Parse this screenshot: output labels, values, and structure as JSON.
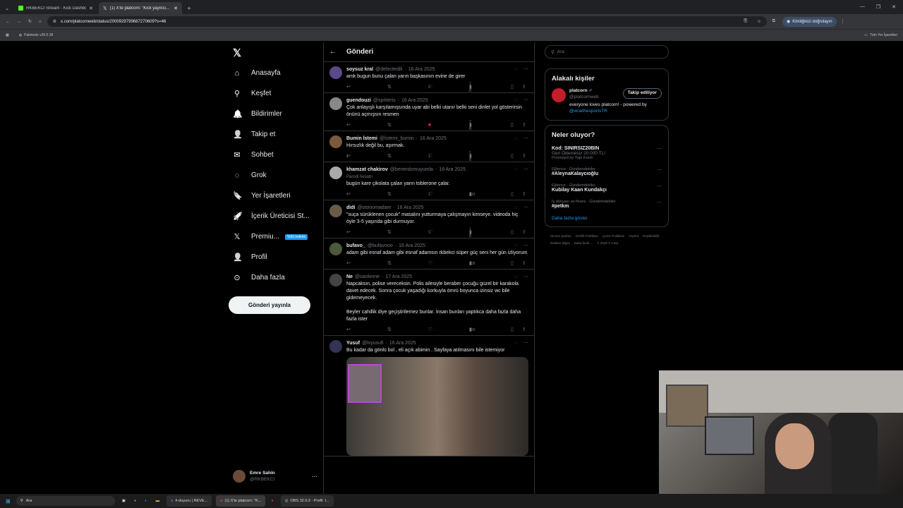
{
  "browser": {
    "tabs": [
      {
        "title": "RKBEKCI Stream - Kick Dashbo...",
        "icon_color": "#53fc18"
      },
      {
        "title": "(1) X'te platcorn: \"Kick yayıncı...",
        "icon_color": "#ffffff"
      }
    ],
    "url": "x.com/platcornweb/status/2000929799687270609?s=46",
    "profile_button": "Kimliğinizi doğrulayın",
    "bookmark": "Paletools v26.0.28",
    "all_bookmarks": "Tüm Yer İşaretleri"
  },
  "nav": {
    "items": [
      {
        "label": "Anasayfa",
        "icon": "home-icon"
      },
      {
        "label": "Keşfet",
        "icon": "search-icon"
      },
      {
        "label": "Bildirimler",
        "icon": "bell-icon"
      },
      {
        "label": "Takip et",
        "icon": "add-user-icon"
      },
      {
        "label": "Sohbet",
        "icon": "mail-icon"
      },
      {
        "label": "Grok",
        "icon": "grok-icon"
      },
      {
        "label": "Yer İşaretleri",
        "icon": "bookmark-icon"
      },
      {
        "label": "İçerik Üreticisi St...",
        "icon": "rocket-icon"
      },
      {
        "label": "Premiu...",
        "icon": "x-icon"
      },
      {
        "label": "Profil",
        "icon": "person-icon"
      },
      {
        "label": "Daha fazla",
        "icon": "more-circle-icon"
      }
    ],
    "premium_badge": "%50 indirim",
    "post_button": "Gönderi yayınla",
    "user": {
      "name": "Emre Sahin",
      "handle": "@RKBEKCI"
    }
  },
  "feed": {
    "title": "Gönderi",
    "tweets": [
      {
        "name": "soysuz kral",
        "handle": "@delectedili",
        "date": "16 Ara 2025",
        "text": "amk bugun bunu çalan yarın başkasının evine de girer",
        "replies": "",
        "retweets": "",
        "likes": "6",
        "views": "1 B",
        "liked": false
      },
      {
        "name": "guendouzi",
        "handle": "@spriteris",
        "date": "16 Ara 2025",
        "text": "Çok anlayışlı karşılamışsında uyar abi belki utanır belki seni dinlet yol gösterirsin önünü açmışsın resmen",
        "replies": "",
        "retweets": "",
        "likes": "5",
        "views": "2 B",
        "liked": true
      },
      {
        "name": "Bumin İstemi",
        "handle": "@İstemi_bumin",
        "date": "16 Ara 2025",
        "text": "Hırsızlık değil bu, aşırmak.",
        "replies": "1",
        "retweets": "",
        "likes": "1",
        "views": "1 B",
        "liked": false
      },
      {
        "name": "khamzat chakirov",
        "handle": "@benerdomuyumla",
        "date": "16 Ara 2025",
        "sub": "Parodi hesabı",
        "text": "bugün kare çikolata çalan yarın toblerone çalar.",
        "replies": "",
        "retweets": "",
        "likes": "1",
        "views": "819",
        "liked": false
      },
      {
        "name": "didi",
        "handle": "@otonomadam",
        "date": "16 Ara 2025",
        "text": "\"suça sürüklenen çocuk\" masalını yutturmaya çalışmayın kimseye. videoda hiç öyle 3-5 yaşında gibi durmuyor.",
        "replies": "",
        "retweets": "",
        "likes": "1",
        "views": "1 B",
        "liked": false
      },
      {
        "name": "bufavo_",
        "handle": "@bufavooo",
        "date": "16 Ara 2025",
        "text": "adam gibi esnaf adam gibi esnaf adamsın rkbekci süper güç seni her gün izliyorum",
        "replies": "",
        "retweets": "",
        "likes": "",
        "views": "408",
        "liked": false
      },
      {
        "name": "Ne",
        "handle": "@sankinne",
        "date": "17 Ara 2025",
        "text": "Napcaksın, polise vereceksin. Polis ailesiyle beraber çocuğu güzel bir karakola davet edecek. Sonra çocuk yaşadığı korkuyla ömrü boyunca izinsiz wc bile gidemeyecek.",
        "text2": "Beyler cahillik diye geçiştirilemez bunlar. İnsan bunları yaptıkca daha fazla daha fazla ister",
        "replies": "",
        "retweets": "",
        "likes": "",
        "views": "309",
        "liked": false
      },
      {
        "name": "Yusuf",
        "handle": "@lxyusufi",
        "date": "16 Ara 2025",
        "text": "Bu kadar da gönlü bol , eli açık abimin . Sayfaya atılmasını bile istemiyor",
        "has_image": true
      }
    ]
  },
  "right": {
    "search_placeholder": "Ara",
    "related_title": "Alakalı kişiler",
    "related": {
      "name": "platcorn",
      "handle": "@platcornweb",
      "follow": "Takip ediliyor",
      "bio": "everyone loves platcorn! - powered by",
      "bio_link": "@wraithesportsTR"
    },
    "trends_title": "Neler oluyor?",
    "trends": [
      {
        "name": "Kod: SINIRSIZ20BIN",
        "sub": "Geri Ödemesiz 20.000 TL!",
        "cat": "Promoted by Yapı Kredi"
      },
      {
        "cat": "Eğlence · Gündemdekiler",
        "name": "#AleynaKalaycıoğlu"
      },
      {
        "cat": "Eğlence · Gündemdekiler",
        "name": "Kubilay Kaan Kundakçı"
      },
      {
        "cat": "İş dünyası ve finans · Gündemdekiler",
        "name": "#petkm"
      }
    ],
    "show_more": "Daha fazla göster",
    "footer": [
      "Hizmet Şartları",
      "Gizlilik Politikası",
      "Çerez Politikası",
      "Imprint",
      "Erişilebilirlik",
      "Reklam bilgisi",
      "Daha fazla ...",
      "© 2025 X Corp."
    ]
  },
  "taskbar": {
    "search": "Ara",
    "apps": [
      "#-duyuru | REVE...",
      "(1) X'te platcorn: \"K...",
      "OBS 32.0.2 - Profil: I..."
    ]
  }
}
